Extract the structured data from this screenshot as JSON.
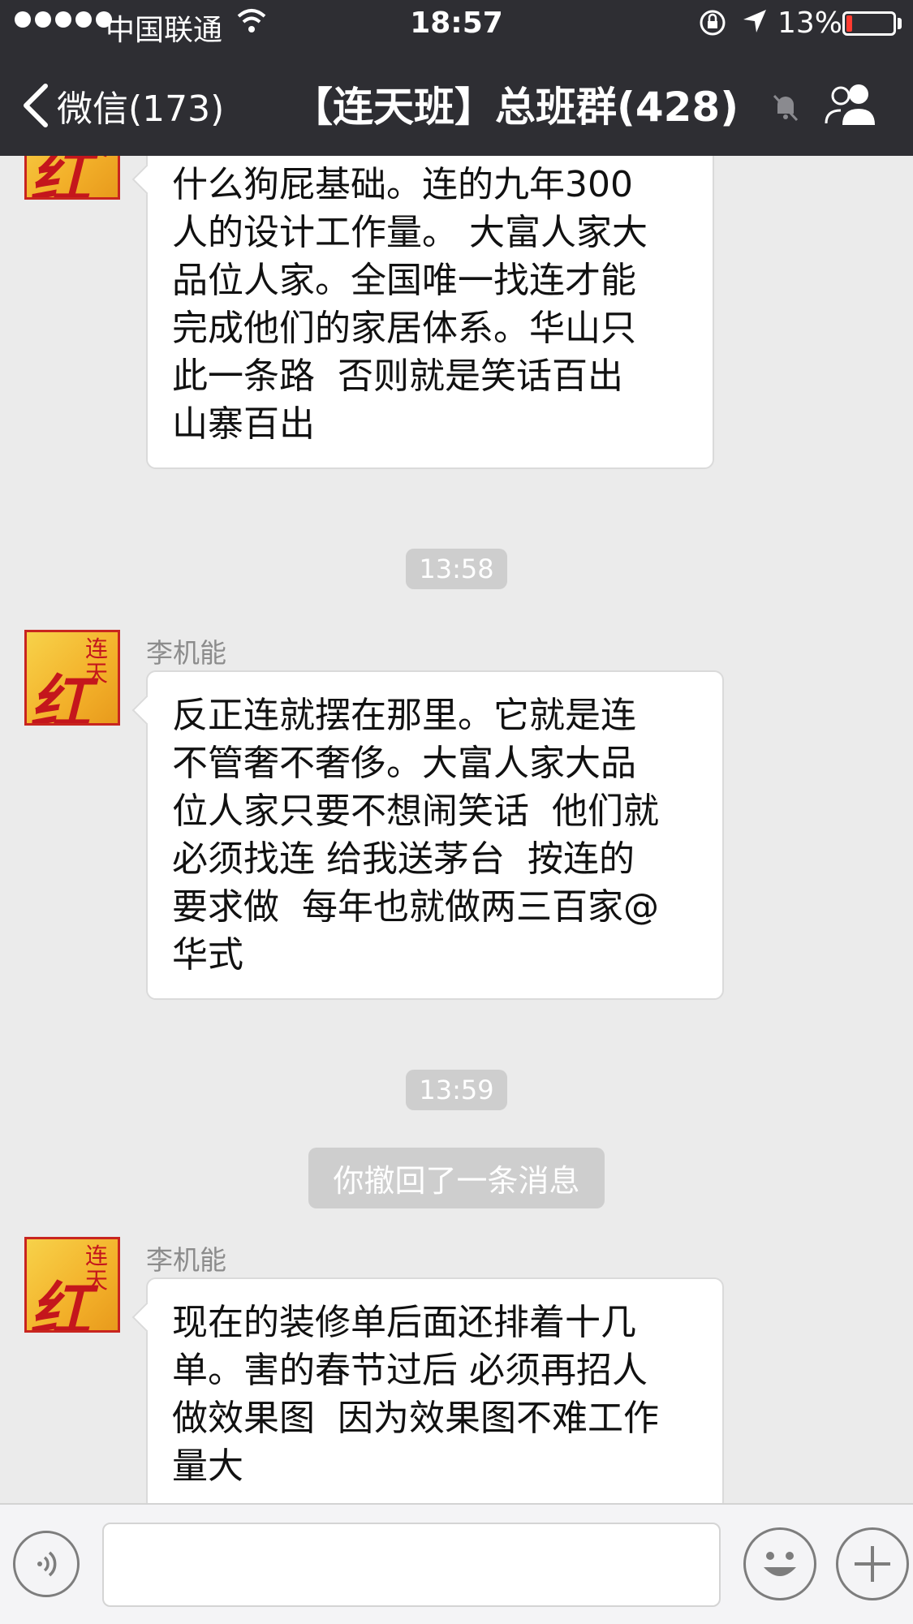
{
  "status_bar": {
    "carrier": "中国联通",
    "time": "18:57",
    "battery_percent": "13%",
    "battery_level": 0.13
  },
  "nav": {
    "back_label": "微信(173)",
    "title": "【连天班】总班群(428)",
    "icons": [
      "chevron-left-icon",
      "mute-bell-icon",
      "group-members-icon"
    ]
  },
  "chat": {
    "messages": [
      {
        "sender": "",
        "lines": [
          "什么狗屁基础。连的九年300",
          "人的设计工作量。 大富人家大",
          "品位人家。全国唯一找连才能",
          "完成他们的家居体系。华山只",
          "此一条路  否则就是笑话百出",
          "山寨百出"
        ]
      },
      {
        "sender": "李机能",
        "lines": [
          "反正连就摆在那里。它就是连",
          "不管奢不奢侈。大富人家大品",
          "位人家只要不想闹笑话  他们就",
          "必须找连 给我送茅台  按连的",
          "要求做  每年也就做两三百家@",
          "华式"
        ]
      },
      {
        "sender": "李机能",
        "lines": [
          "现在的装修单后面还排着十几",
          "单。害的春节过后 必须再招人",
          "做效果图  因为效果图不难工作",
          "量大"
        ]
      }
    ],
    "timestamps": [
      "13:58",
      "13:59"
    ],
    "system_message": "你撤回了一条消息"
  },
  "input_bar": {
    "icons": [
      "voice-icon",
      "emoji-icon",
      "plus-icon"
    ]
  }
}
